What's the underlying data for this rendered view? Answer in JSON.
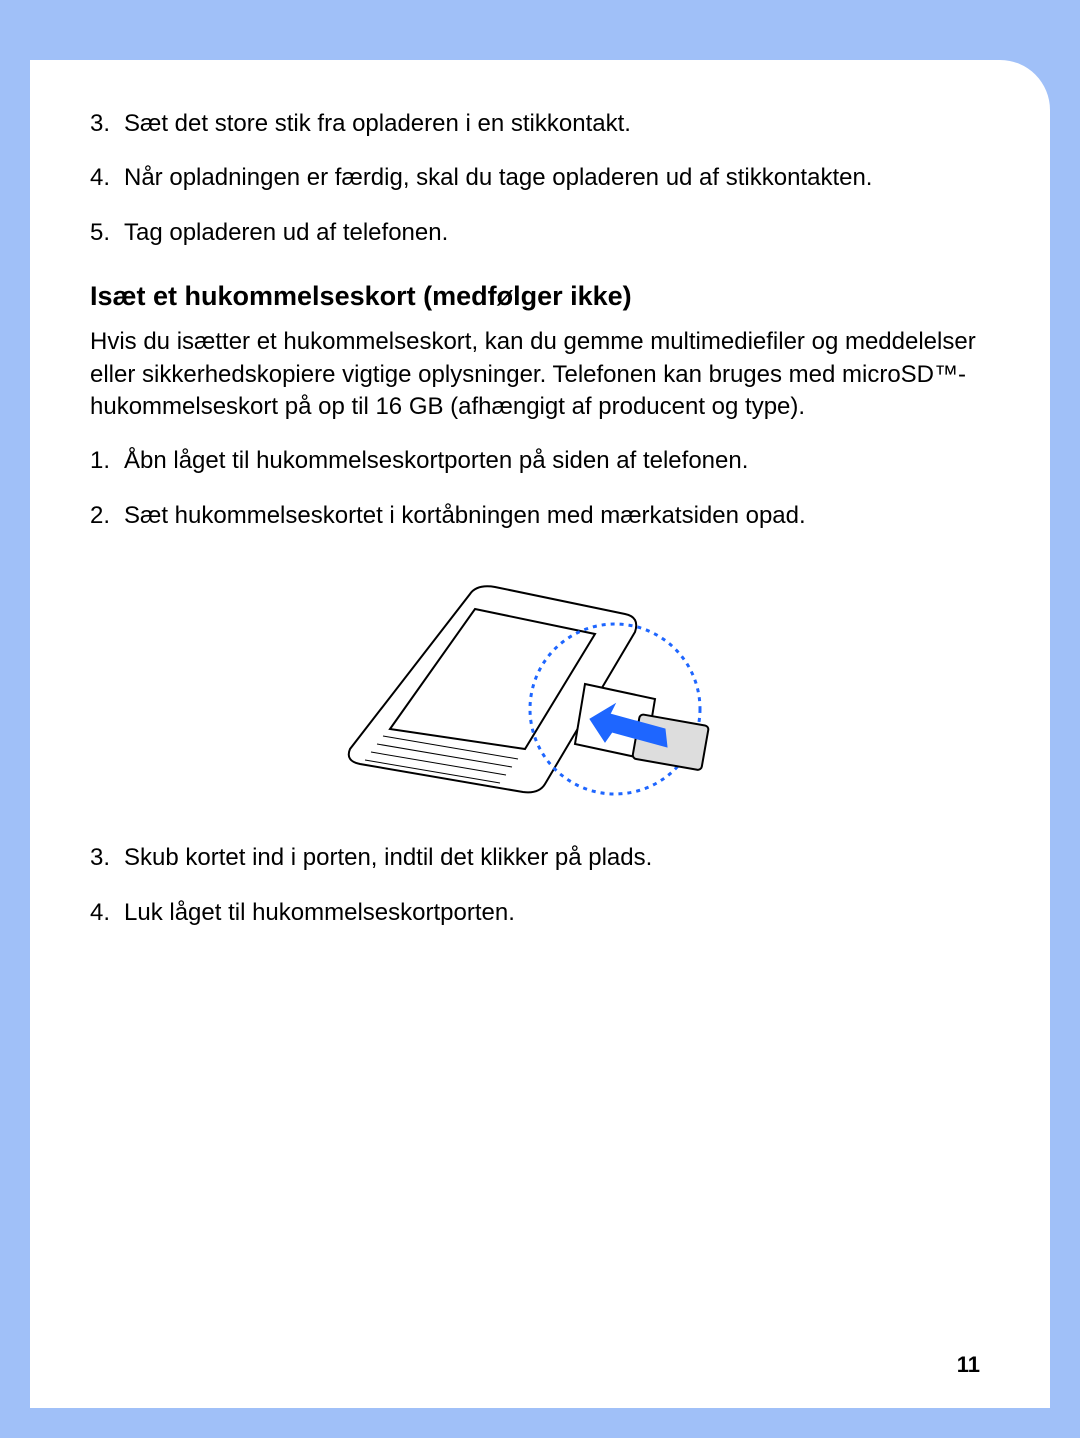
{
  "topList": [
    {
      "num": "3.",
      "text": "Sæt det store stik fra opladeren i en stikkontakt."
    },
    {
      "num": "4.",
      "text": "Når opladningen er færdig, skal du tage opladeren ud af stikkontakten."
    },
    {
      "num": "5.",
      "text": "Tag opladeren ud af telefonen."
    }
  ],
  "heading": "Isæt et hukommelseskort (medfølger ikke)",
  "intro": "Hvis du isætter et hukommelseskort, kan du gemme multimediefiler og meddelelser eller sikkerhedskopiere vigtige oplysninger. Telefonen kan bruges med microSD™-hukommelseskort på op til 16 GB (afhængigt af producent og type).",
  "midList": [
    {
      "num": "1.",
      "text": "Åbn låget til hukommelseskortporten på siden af telefonen."
    },
    {
      "num": "2.",
      "text": "Sæt hukommelseskortet i kortåbningen med mærkatsiden opad."
    }
  ],
  "bottomList": [
    {
      "num": "3.",
      "text": "Skub kortet ind i porten, indtil det klikker på plads."
    },
    {
      "num": "4.",
      "text": "Luk låget til hukommelseskortporten."
    }
  ],
  "pageNumber": "11"
}
